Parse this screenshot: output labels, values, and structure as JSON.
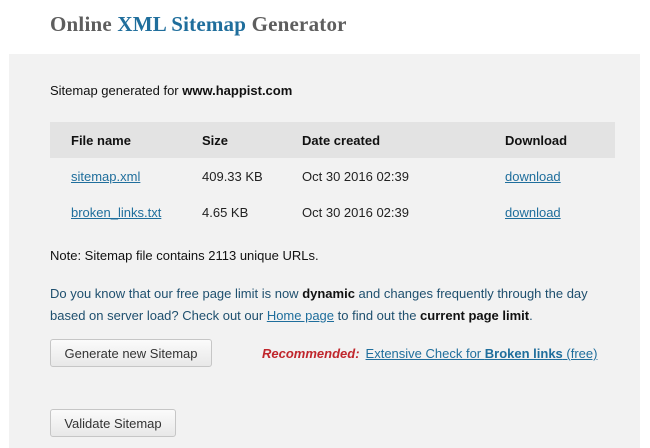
{
  "header": {
    "title_part1": "Online ",
    "title_part2": "XML Sitemap",
    "title_part3": " Generator"
  },
  "result": {
    "generated_prefix": "Sitemap generated for ",
    "domain": "www.happist.com"
  },
  "table": {
    "headers": [
      "File name",
      "Size",
      "Date created",
      "Download"
    ],
    "rows": [
      {
        "file": "sitemap.xml",
        "size": "409.33 KB",
        "date": "Oct 30 2016 02:39",
        "download": "download"
      },
      {
        "file": "broken_links.txt",
        "size": "4.65 KB",
        "date": "Oct 30 2016 02:39",
        "download": "download"
      }
    ]
  },
  "note": "Note: Sitemap file contains 2113 unique URLs.",
  "info": {
    "t1": "Do you know that our free page limit is now ",
    "b1": "dynamic",
    "t2": " and changes frequently through the day based on server load? Check out our ",
    "home_link": "Home page",
    "t3": " to find out the ",
    "b2": "current page limit",
    "t4": "."
  },
  "buttons": {
    "generate": "Generate new Sitemap",
    "validate": "Validate Sitemap"
  },
  "recommend": {
    "label": "Recommended:",
    "link_text1": "Extensive Check for ",
    "link_bold": "Broken links",
    "link_text2": " (free)"
  },
  "colors": {
    "accent": "#1f6e9c",
    "title_gray": "#5e5e5e",
    "recommend_red": "#c0262c",
    "panel_bg": "#f2f2f2",
    "table_header_bg": "#e3e3e3"
  }
}
